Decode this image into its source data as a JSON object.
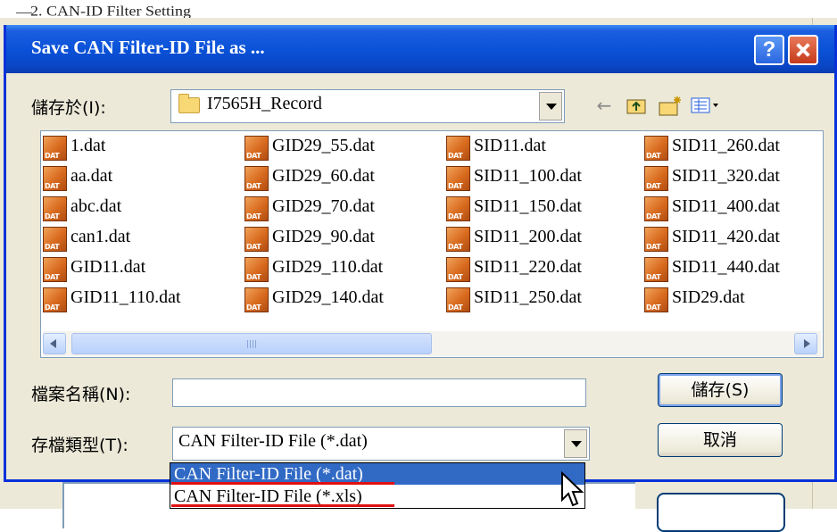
{
  "background_window": {
    "title": "2. CAN-ID Filter Setting"
  },
  "dialog": {
    "title": "Save CAN Filter-ID File as ...",
    "help_glyph": "?",
    "save_in": {
      "label": "儲存於(I):",
      "value": "I7565H_Record"
    },
    "toolbar": {
      "back_icon": "back-arrow-icon",
      "up_icon": "folder-up-icon",
      "new_folder_icon": "new-folder-icon",
      "view_menu_icon": "view-menu-icon"
    },
    "files": [
      [
        "1.dat",
        "aa.dat",
        "abc.dat",
        "can1.dat",
        "GID11.dat",
        "GID11_110.dat"
      ],
      [
        "GID29_55.dat",
        "GID29_60.dat",
        "GID29_70.dat",
        "GID29_90.dat",
        "GID29_110.dat",
        "GID29_140.dat"
      ],
      [
        "SID11.dat",
        "SID11_100.dat",
        "SID11_150.dat",
        "SID11_200.dat",
        "SID11_220.dat",
        "SID11_250.dat"
      ],
      [
        "SID11_260.dat",
        "SID11_320.dat",
        "SID11_400.dat",
        "SID11_420.dat",
        "SID11_440.dat",
        "SID29.dat"
      ]
    ],
    "filename": {
      "label": "檔案名稱(N):",
      "value": ""
    },
    "filetype": {
      "label": "存檔類型(T):",
      "value": "CAN Filter-ID File (*.dat)",
      "options": [
        "CAN Filter-ID File (*.dat)",
        "CAN Filter-ID File (*.xls)"
      ]
    },
    "save_button": "儲存(S)",
    "cancel_button": "取消"
  },
  "colors": {
    "titlebar": "#0a52d8",
    "selection": "#316ac5",
    "annotation_underline": "#e01010"
  }
}
